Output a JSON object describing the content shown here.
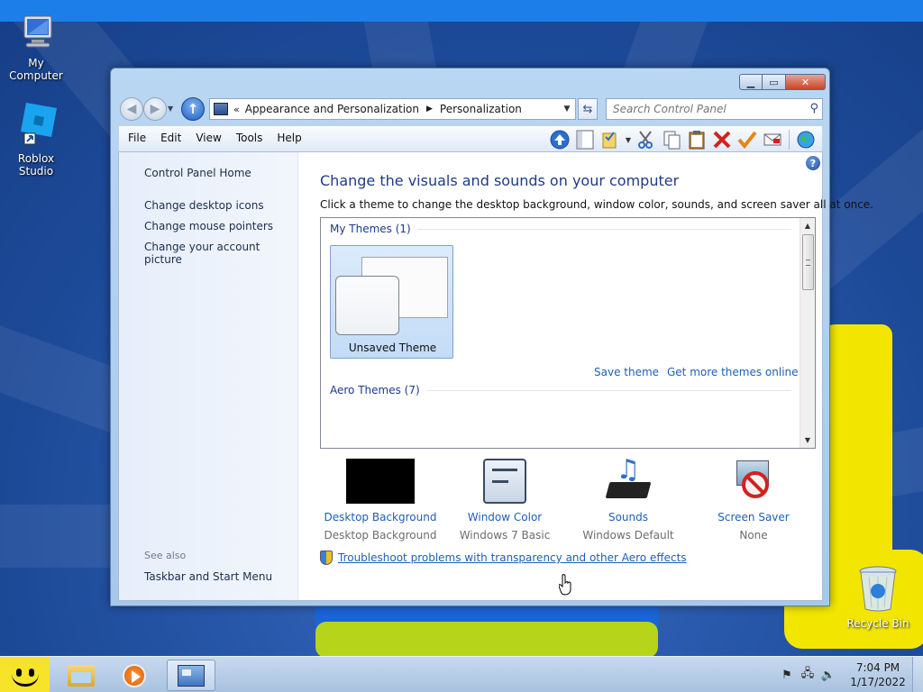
{
  "desktop": {
    "icons": [
      {
        "label": "My Computer"
      },
      {
        "label": "Roblox Studio"
      },
      {
        "label": "Recycle Bin"
      }
    ]
  },
  "window": {
    "address": {
      "crumbs": [
        "Appearance and Personalization",
        "Personalization"
      ]
    },
    "search": {
      "placeholder": "Search Control Panel"
    },
    "menu": [
      "File",
      "Edit",
      "View",
      "Tools",
      "Help"
    ],
    "sidebar": {
      "home": "Control Panel Home",
      "links": [
        "Change desktop icons",
        "Change mouse pointers",
        "Change your account picture"
      ],
      "see_also_heading": "See also",
      "see_also": [
        "Taskbar and Start Menu"
      ]
    },
    "main": {
      "title": "Change the visuals and sounds on your computer",
      "description": "Click a theme to change the desktop background, window color, sounds, and screen saver all at once.",
      "my_themes": "My Themes (1)",
      "aero_themes": "Aero Themes (7)",
      "theme_tile": "Unsaved Theme",
      "save_theme": "Save theme",
      "get_more": "Get more themes online",
      "bottom_items": [
        {
          "title": "Desktop Background",
          "subtitle": "Desktop Background"
        },
        {
          "title": "Window Color",
          "subtitle": "Windows 7 Basic"
        },
        {
          "title": "Sounds",
          "subtitle": "Windows Default"
        },
        {
          "title": "Screen Saver",
          "subtitle": "None"
        }
      ],
      "troubleshoot": "Troubleshoot problems with transparency and other Aero effects"
    }
  },
  "taskbar": {
    "time": "7:04 PM",
    "date": "1/17/2022"
  },
  "colors": {
    "link": "#1e5fb8",
    "title": "#1e3a8a",
    "start": "#f6e32a"
  }
}
